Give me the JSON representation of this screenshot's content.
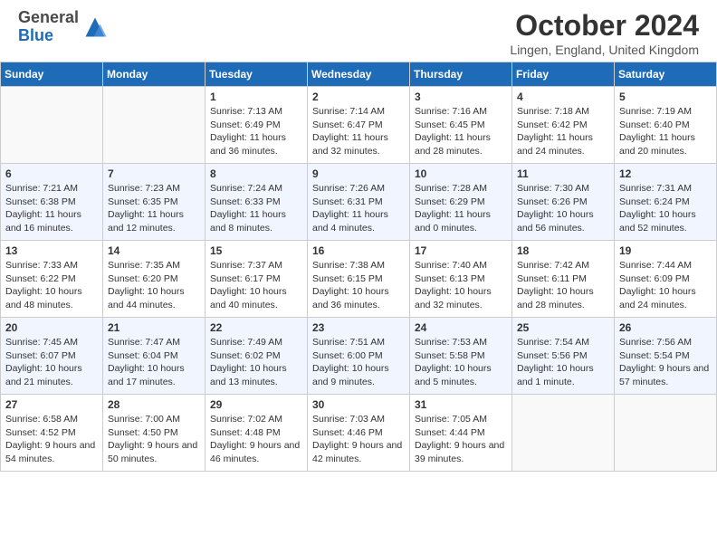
{
  "header": {
    "title": "October 2024",
    "location": "Lingen, England, United Kingdom",
    "logo_general": "General",
    "logo_blue": "Blue"
  },
  "days_of_week": [
    "Sunday",
    "Monday",
    "Tuesday",
    "Wednesday",
    "Thursday",
    "Friday",
    "Saturday"
  ],
  "weeks": [
    [
      {
        "day": "",
        "info": ""
      },
      {
        "day": "",
        "info": ""
      },
      {
        "day": "1",
        "info": "Sunrise: 7:13 AM\nSunset: 6:49 PM\nDaylight: 11 hours and 36 minutes."
      },
      {
        "day": "2",
        "info": "Sunrise: 7:14 AM\nSunset: 6:47 PM\nDaylight: 11 hours and 32 minutes."
      },
      {
        "day": "3",
        "info": "Sunrise: 7:16 AM\nSunset: 6:45 PM\nDaylight: 11 hours and 28 minutes."
      },
      {
        "day": "4",
        "info": "Sunrise: 7:18 AM\nSunset: 6:42 PM\nDaylight: 11 hours and 24 minutes."
      },
      {
        "day": "5",
        "info": "Sunrise: 7:19 AM\nSunset: 6:40 PM\nDaylight: 11 hours and 20 minutes."
      }
    ],
    [
      {
        "day": "6",
        "info": "Sunrise: 7:21 AM\nSunset: 6:38 PM\nDaylight: 11 hours and 16 minutes."
      },
      {
        "day": "7",
        "info": "Sunrise: 7:23 AM\nSunset: 6:35 PM\nDaylight: 11 hours and 12 minutes."
      },
      {
        "day": "8",
        "info": "Sunrise: 7:24 AM\nSunset: 6:33 PM\nDaylight: 11 hours and 8 minutes."
      },
      {
        "day": "9",
        "info": "Sunrise: 7:26 AM\nSunset: 6:31 PM\nDaylight: 11 hours and 4 minutes."
      },
      {
        "day": "10",
        "info": "Sunrise: 7:28 AM\nSunset: 6:29 PM\nDaylight: 11 hours and 0 minutes."
      },
      {
        "day": "11",
        "info": "Sunrise: 7:30 AM\nSunset: 6:26 PM\nDaylight: 10 hours and 56 minutes."
      },
      {
        "day": "12",
        "info": "Sunrise: 7:31 AM\nSunset: 6:24 PM\nDaylight: 10 hours and 52 minutes."
      }
    ],
    [
      {
        "day": "13",
        "info": "Sunrise: 7:33 AM\nSunset: 6:22 PM\nDaylight: 10 hours and 48 minutes."
      },
      {
        "day": "14",
        "info": "Sunrise: 7:35 AM\nSunset: 6:20 PM\nDaylight: 10 hours and 44 minutes."
      },
      {
        "day": "15",
        "info": "Sunrise: 7:37 AM\nSunset: 6:17 PM\nDaylight: 10 hours and 40 minutes."
      },
      {
        "day": "16",
        "info": "Sunrise: 7:38 AM\nSunset: 6:15 PM\nDaylight: 10 hours and 36 minutes."
      },
      {
        "day": "17",
        "info": "Sunrise: 7:40 AM\nSunset: 6:13 PM\nDaylight: 10 hours and 32 minutes."
      },
      {
        "day": "18",
        "info": "Sunrise: 7:42 AM\nSunset: 6:11 PM\nDaylight: 10 hours and 28 minutes."
      },
      {
        "day": "19",
        "info": "Sunrise: 7:44 AM\nSunset: 6:09 PM\nDaylight: 10 hours and 24 minutes."
      }
    ],
    [
      {
        "day": "20",
        "info": "Sunrise: 7:45 AM\nSunset: 6:07 PM\nDaylight: 10 hours and 21 minutes."
      },
      {
        "day": "21",
        "info": "Sunrise: 7:47 AM\nSunset: 6:04 PM\nDaylight: 10 hours and 17 minutes."
      },
      {
        "day": "22",
        "info": "Sunrise: 7:49 AM\nSunset: 6:02 PM\nDaylight: 10 hours and 13 minutes."
      },
      {
        "day": "23",
        "info": "Sunrise: 7:51 AM\nSunset: 6:00 PM\nDaylight: 10 hours and 9 minutes."
      },
      {
        "day": "24",
        "info": "Sunrise: 7:53 AM\nSunset: 5:58 PM\nDaylight: 10 hours and 5 minutes."
      },
      {
        "day": "25",
        "info": "Sunrise: 7:54 AM\nSunset: 5:56 PM\nDaylight: 10 hours and 1 minute."
      },
      {
        "day": "26",
        "info": "Sunrise: 7:56 AM\nSunset: 5:54 PM\nDaylight: 9 hours and 57 minutes."
      }
    ],
    [
      {
        "day": "27",
        "info": "Sunrise: 6:58 AM\nSunset: 4:52 PM\nDaylight: 9 hours and 54 minutes."
      },
      {
        "day": "28",
        "info": "Sunrise: 7:00 AM\nSunset: 4:50 PM\nDaylight: 9 hours and 50 minutes."
      },
      {
        "day": "29",
        "info": "Sunrise: 7:02 AM\nSunset: 4:48 PM\nDaylight: 9 hours and 46 minutes."
      },
      {
        "day": "30",
        "info": "Sunrise: 7:03 AM\nSunset: 4:46 PM\nDaylight: 9 hours and 42 minutes."
      },
      {
        "day": "31",
        "info": "Sunrise: 7:05 AM\nSunset: 4:44 PM\nDaylight: 9 hours and 39 minutes."
      },
      {
        "day": "",
        "info": ""
      },
      {
        "day": "",
        "info": ""
      }
    ]
  ]
}
